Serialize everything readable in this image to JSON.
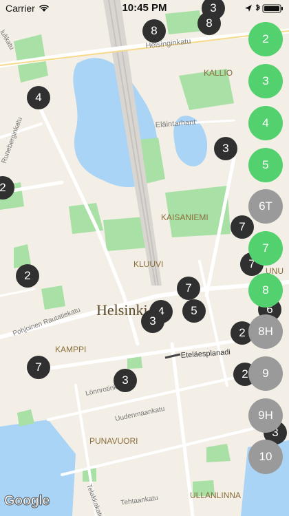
{
  "status_bar": {
    "carrier": "Carrier",
    "time": "10:45 PM"
  },
  "map": {
    "labels": {
      "helsinginkatu": "Helsinginkatu",
      "kallio": "KALLIO",
      "elaintarha": "Eläintarhant",
      "kaisaniemi": "KAISANIEMI",
      "kluuvi": "KLUUVI",
      "helsinki": "Helsinki",
      "pohjoinen_rautatiekatu": "Pohjoinen Rautatiekatu",
      "kamppi": "KAMPPI",
      "etelaesplanadi": "Eteläesplanadi",
      "lonnrotinkatu": "Lönnrotinkatu",
      "uudenmaankatu": "Uudenmaankatu",
      "punavuori": "PUNAVUORI",
      "tehtaankatu": "Tehtaankatu",
      "ullanlinna": "ULLANLINNA",
      "left_street_1": "lulikatu",
      "left_street_2": "Runeberginkatu",
      "bottom_street": "Telakkakatu",
      "right_partial_1": "UNU",
      "google": "Google"
    },
    "markers": [
      {
        "label": "3"
      },
      {
        "label": "8"
      },
      {
        "label": "8"
      },
      {
        "label": "4"
      },
      {
        "label": "3"
      },
      {
        "label": "2"
      },
      {
        "label": "7"
      },
      {
        "label": "7"
      },
      {
        "label": "2"
      },
      {
        "label": "7"
      },
      {
        "label": "4"
      },
      {
        "label": "5"
      },
      {
        "label": "3"
      },
      {
        "label": "6"
      },
      {
        "label": "2"
      },
      {
        "label": "7"
      },
      {
        "label": "2"
      },
      {
        "label": "3"
      },
      {
        "label": "3"
      }
    ]
  },
  "line_buttons": [
    {
      "label": "2",
      "color": "#53d16f"
    },
    {
      "label": "3",
      "color": "#53d16f"
    },
    {
      "label": "4",
      "color": "#53d16f"
    },
    {
      "label": "5",
      "color": "#53d16f"
    },
    {
      "label": "6T",
      "color": "#9a9a9a"
    },
    {
      "label": "7",
      "color": "#53d16f"
    },
    {
      "label": "8",
      "color": "#53d16f"
    },
    {
      "label": "8H",
      "color": "#9a9a9a"
    },
    {
      "label": "9",
      "color": "#9a9a9a"
    },
    {
      "label": "9H",
      "color": "#9a9a9a"
    },
    {
      "label": "10",
      "color": "#9a9a9a"
    }
  ]
}
